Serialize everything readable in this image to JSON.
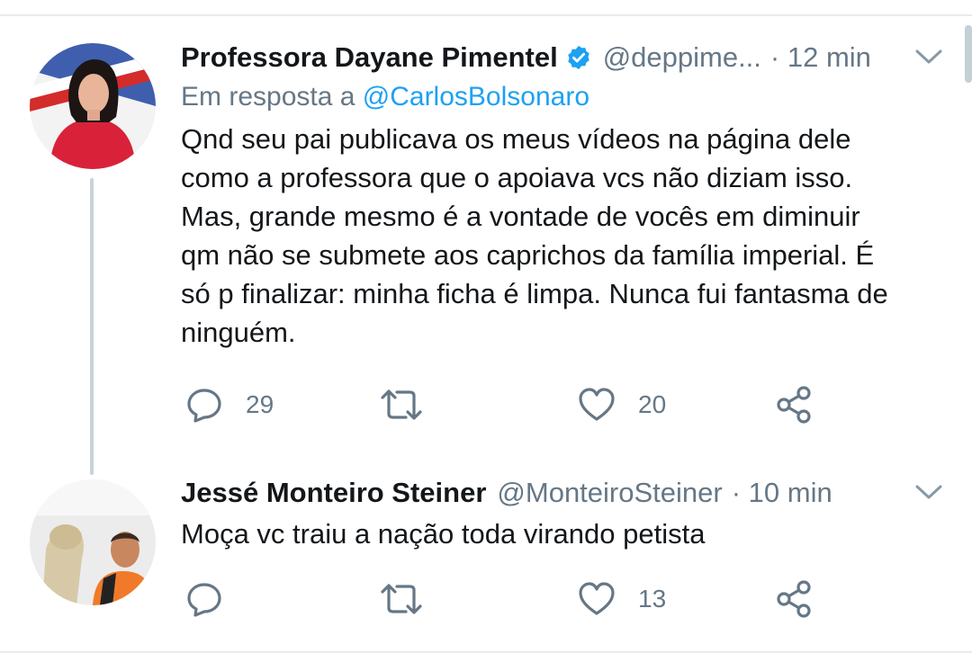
{
  "tweets": [
    {
      "author_name": "Professora Dayane Pimentel",
      "verified": true,
      "handle": "@deppime...",
      "time": "· 12 min",
      "reply_prefix": "Em resposta a",
      "reply_mention": "@CarlosBolsonaro",
      "text": "Qnd seu pai publicava os meus vídeos na página dele\ncomo a professora que o apoiava vcs não diziam isso.\nMas, grande mesmo é a vontade de vocês em diminuir\nqm não se submete aos caprichos da família imperial. É\nsó p finalizar: minha ficha é limpa. Nunca fui fantasma de\nninguém.",
      "reply_count": "29",
      "retweet_count": "",
      "like_count": "20"
    },
    {
      "author_name": "Jessé Monteiro Steiner",
      "handle": "@MonteiroSteiner",
      "time": "· 10 min",
      "text": "Moça vc traiu a nação toda virando petista",
      "reply_count": "",
      "retweet_count": "",
      "like_count": "13"
    }
  ],
  "icons": {
    "reply": "speech-bubble-icon",
    "retweet": "retweet-arrows-icon",
    "like": "heart-outline-icon",
    "share": "share-nodes-icon",
    "menu": "chevron-down-icon",
    "verified": "verified-badge-icon"
  },
  "colors": {
    "verified": "#1da1f2",
    "mention": "#1da1f2",
    "secondary_text": "#657786",
    "thread_line": "#c8d3da"
  }
}
